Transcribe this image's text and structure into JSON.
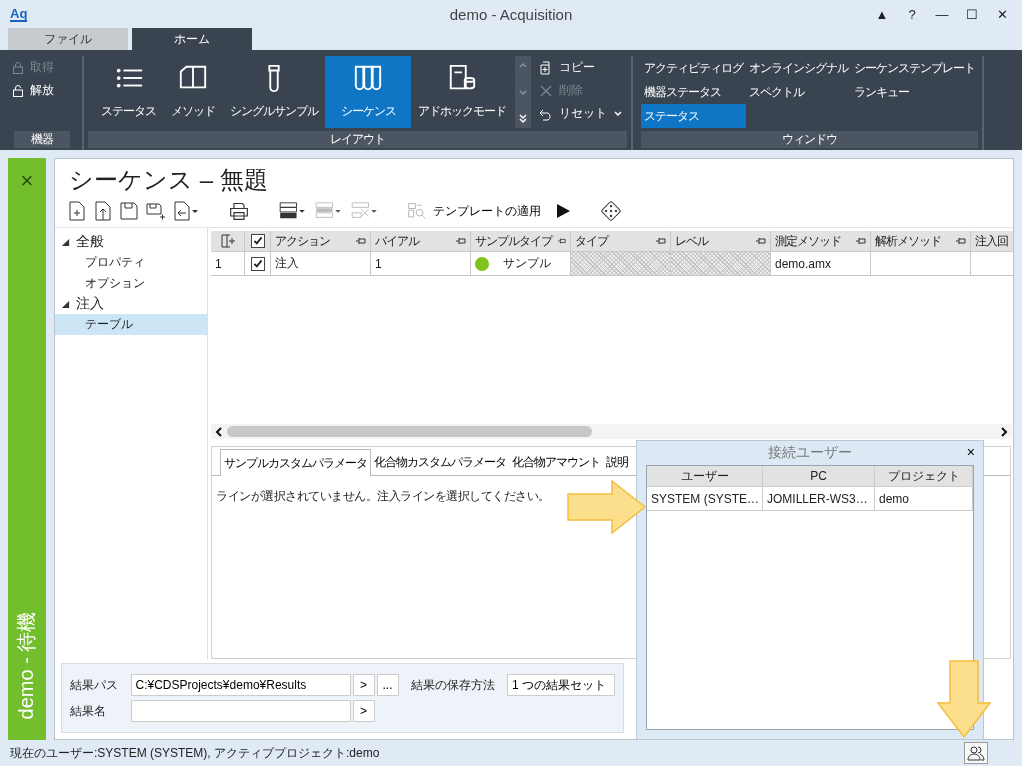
{
  "window": {
    "logo": "Aq",
    "title": "demo - Acquisition",
    "controls": [
      "▲",
      "?",
      "—",
      "☐",
      "✕"
    ]
  },
  "ribbon_tabs": [
    {
      "label": "ファイル",
      "selected": false
    },
    {
      "label": "ホーム",
      "selected": true
    }
  ],
  "ribbon": {
    "device": {
      "title": "機器",
      "items": [
        {
          "label": "取得",
          "disabled": true
        },
        {
          "label": "解放",
          "disabled": false
        }
      ]
    },
    "layout": {
      "title": "レイアウト",
      "buttons": [
        {
          "label": "ステータス",
          "selected": false
        },
        {
          "label": "メソッド",
          "selected": false
        },
        {
          "label": "シングルサンプル",
          "selected": false
        },
        {
          "label": "シーケンス",
          "selected": true
        },
        {
          "label": "アドホックモード",
          "selected": false
        }
      ],
      "actions": [
        {
          "label": "コピー",
          "disabled": false
        },
        {
          "label": "削除",
          "disabled": true
        },
        {
          "label": "リセット",
          "disabled": false
        }
      ]
    },
    "window": {
      "title": "ウィンドウ",
      "items": [
        {
          "label": "アクティビティログ",
          "selected": false
        },
        {
          "label": "オンラインシグナル",
          "selected": false
        },
        {
          "label": "シーケンステンプレート",
          "selected": false
        },
        {
          "label": "機器ステータス",
          "selected": false
        },
        {
          "label": "スペクトル",
          "selected": false
        },
        {
          "label": "ランキュー",
          "selected": false
        },
        {
          "label": "ステータス",
          "selected": true
        }
      ]
    }
  },
  "side_panel": {
    "close": "×",
    "label": "demo - 待機"
  },
  "document": {
    "title": "シーケンス – 無題",
    "apply_template": "テンプレートの適用"
  },
  "nav_tree": [
    {
      "label": "全般",
      "expanded": true,
      "children": [
        {
          "label": "プロパティ",
          "selected": false
        },
        {
          "label": "オプション",
          "selected": false
        }
      ]
    },
    {
      "label": "注入",
      "expanded": true,
      "children": [
        {
          "label": "テーブル",
          "selected": true
        }
      ]
    }
  ],
  "table": {
    "all_checked": true,
    "columns": [
      {
        "label": "アクション",
        "locked": false
      },
      {
        "label": "バイアル",
        "locked": false
      },
      {
        "label": "サンプルタイプ",
        "locked": false
      },
      {
        "label": "タイプ",
        "locked": true
      },
      {
        "label": "レベル",
        "locked": true
      },
      {
        "label": "測定メソッド",
        "locked": false
      },
      {
        "label": "解析メソッド",
        "locked": false
      },
      {
        "label": "注入回",
        "locked": false
      }
    ],
    "rows": [
      {
        "number": "1",
        "checked": true,
        "action": "注入",
        "vial": "1",
        "sample_type": "サンプル",
        "color": "#7dc31c",
        "acquisition_method": "demo.amx"
      }
    ]
  },
  "detail_tabs": [
    {
      "label": "サンプルカスタムパラメータ",
      "selected": true
    },
    {
      "label": "化合物カスタムパラメータ",
      "selected": false
    },
    {
      "label": "化合物アマウント",
      "selected": false
    },
    {
      "label": "説明",
      "selected": false
    }
  ],
  "detail_message": "ラインが選択されていません。注入ラインを選択してください。",
  "results": {
    "path_label": "結果パス",
    "path": "C:¥CDSProjects¥demo¥Results",
    "path_button": ">",
    "browse_button": "...",
    "save_label": "結果の保存方法",
    "save_value": "1 つの結果セット",
    "name_label": "結果名",
    "name_button": ">"
  },
  "users_dialog": {
    "title": "接続ユーザー",
    "close": "×",
    "columns": [
      "ユーザー",
      "PC",
      "プロジェクト"
    ],
    "rows": [
      {
        "user": "SYSTEM (SYSTE…",
        "pc": "JOMILLER-WS3…",
        "project": "demo"
      }
    ]
  },
  "status_bar": {
    "text": "現在のユーザー:SYSTEM (SYSTEM), アクティブプロジェクト:demo"
  }
}
